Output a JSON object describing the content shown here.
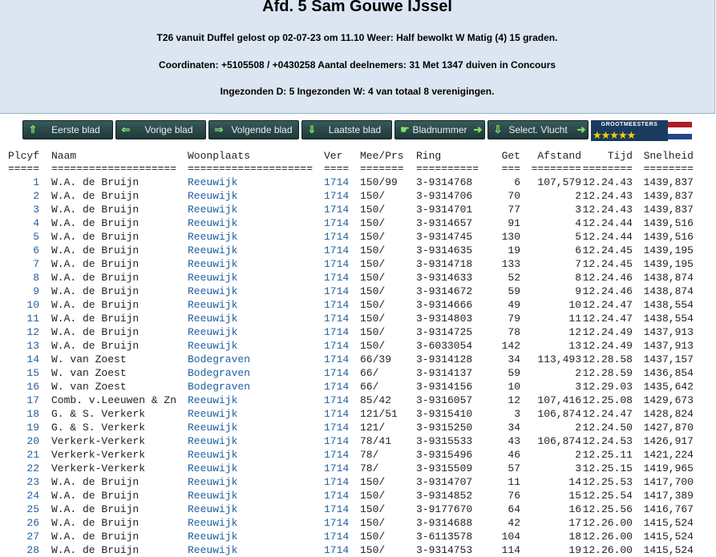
{
  "header": {
    "title": "Afd. 5 Sam Gouwe IJssel",
    "line1": "T26 vanuit Duffel gelost op 02-07-23 om 11.10 Weer: Half bewolkt W Matig (4) 15 graden.",
    "line2": "Coordinaten: +5105508 / +0430258 Aantal deelnemers: 31 Met 1347 duiven in Concours",
    "line3": "Ingezonden D: 5 Ingezonden W: 4 van totaal 8 verenigingen."
  },
  "toolbar": {
    "first": "Eerste blad",
    "prev": "Vorige blad",
    "next": "Volgende blad",
    "last": "Laatste blad",
    "page_number": "Bladnummer",
    "select_flight": "Select. Vlucht",
    "logo_text": "GROOTMEESTERS",
    "logo_stars": "★★★★★"
  },
  "colors": {
    "header_bg": "#dce6f2",
    "link": "#2160a0",
    "button_bg": "#2a4a4a",
    "arrow": "#7ee06a"
  },
  "table": {
    "headers": [
      "Plcyf",
      "Naam",
      "Woonplaats",
      "Ver",
      "Mee/Prs",
      "Ring",
      "Get",
      "Afstand",
      "Tijd",
      "Snelheid"
    ],
    "separators": [
      "=====",
      "====================",
      "====================",
      "====",
      "=======",
      "==========",
      "===",
      "========",
      "========",
      "========"
    ],
    "rows": [
      [
        "1",
        "W.A. de Bruijn",
        "Reeuwijk",
        "1714",
        "150/99",
        "3-9314768",
        "6",
        "107,579",
        "12.24.43",
        "1439,837"
      ],
      [
        "2",
        "W.A. de Bruijn",
        "Reeuwijk",
        "1714",
        "150/",
        "3-9314706",
        "70",
        "2",
        "12.24.43",
        "1439,837"
      ],
      [
        "3",
        "W.A. de Bruijn",
        "Reeuwijk",
        "1714",
        "150/",
        "3-9314701",
        "77",
        "3",
        "12.24.43",
        "1439,837"
      ],
      [
        "4",
        "W.A. de Bruijn",
        "Reeuwijk",
        "1714",
        "150/",
        "3-9314657",
        "91",
        "4",
        "12.24.44",
        "1439,516"
      ],
      [
        "5",
        "W.A. de Bruijn",
        "Reeuwijk",
        "1714",
        "150/",
        "3-9314745",
        "130",
        "5",
        "12.24.44",
        "1439,516"
      ],
      [
        "6",
        "W.A. de Bruijn",
        "Reeuwijk",
        "1714",
        "150/",
        "3-9314635",
        "19",
        "6",
        "12.24.45",
        "1439,195"
      ],
      [
        "7",
        "W.A. de Bruijn",
        "Reeuwijk",
        "1714",
        "150/",
        "3-9314718",
        "133",
        "7",
        "12.24.45",
        "1439,195"
      ],
      [
        "8",
        "W.A. de Bruijn",
        "Reeuwijk",
        "1714",
        "150/",
        "3-9314633",
        "52",
        "8",
        "12.24.46",
        "1438,874"
      ],
      [
        "9",
        "W.A. de Bruijn",
        "Reeuwijk",
        "1714",
        "150/",
        "3-9314672",
        "59",
        "9",
        "12.24.46",
        "1438,874"
      ],
      [
        "10",
        "W.A. de Bruijn",
        "Reeuwijk",
        "1714",
        "150/",
        "3-9314666",
        "49",
        "10",
        "12.24.47",
        "1438,554"
      ],
      [
        "11",
        "W.A. de Bruijn",
        "Reeuwijk",
        "1714",
        "150/",
        "3-9314803",
        "79",
        "11",
        "12.24.47",
        "1438,554"
      ],
      [
        "12",
        "W.A. de Bruijn",
        "Reeuwijk",
        "1714",
        "150/",
        "3-9314725",
        "78",
        "12",
        "12.24.49",
        "1437,913"
      ],
      [
        "13",
        "W.A. de Bruijn",
        "Reeuwijk",
        "1714",
        "150/",
        "3-6033054",
        "142",
        "13",
        "12.24.49",
        "1437,913"
      ],
      [
        "14",
        "W. van Zoest",
        "Bodegraven",
        "1714",
        "66/39",
        "3-9314128",
        "34",
        "113,493",
        "12.28.58",
        "1437,157"
      ],
      [
        "15",
        "W. van Zoest",
        "Bodegraven",
        "1714",
        "66/",
        "3-9314137",
        "59",
        "2",
        "12.28.59",
        "1436,854"
      ],
      [
        "16",
        "W. van Zoest",
        "Bodegraven",
        "1714",
        "66/",
        "3-9314156",
        "10",
        "3",
        "12.29.03",
        "1435,642"
      ],
      [
        "17",
        "Comb. v.Leeuwen & Zn",
        "Reeuwijk",
        "1714",
        "85/42",
        "3-9316057",
        "12",
        "107,416",
        "12.25.08",
        "1429,673"
      ],
      [
        "18",
        "G. & S. Verkerk",
        "Reeuwijk",
        "1714",
        "121/51",
        "3-9315410",
        "3",
        "106,874",
        "12.24.47",
        "1428,824"
      ],
      [
        "19",
        "G. & S. Verkerk",
        "Reeuwijk",
        "1714",
        "121/",
        "3-9315250",
        "34",
        "2",
        "12.24.50",
        "1427,870"
      ],
      [
        "20",
        "Verkerk-Verkerk",
        "Reeuwijk",
        "1714",
        "78/41",
        "3-9315533",
        "43",
        "106,874",
        "12.24.53",
        "1426,917"
      ],
      [
        "21",
        "Verkerk-Verkerk",
        "Reeuwijk",
        "1714",
        "78/",
        "3-9315496",
        "46",
        "2",
        "12.25.11",
        "1421,224"
      ],
      [
        "22",
        "Verkerk-Verkerk",
        "Reeuwijk",
        "1714",
        "78/",
        "3-9315509",
        "57",
        "3",
        "12.25.15",
        "1419,965"
      ],
      [
        "23",
        "W.A. de Bruijn",
        "Reeuwijk",
        "1714",
        "150/",
        "3-9314707",
        "11",
        "14",
        "12.25.53",
        "1417,700"
      ],
      [
        "24",
        "W.A. de Bruijn",
        "Reeuwijk",
        "1714",
        "150/",
        "3-9314852",
        "76",
        "15",
        "12.25.54",
        "1417,389"
      ],
      [
        "25",
        "W.A. de Bruijn",
        "Reeuwijk",
        "1714",
        "150/",
        "3-9177670",
        "64",
        "16",
        "12.25.56",
        "1416,767"
      ],
      [
        "26",
        "W.A. de Bruijn",
        "Reeuwijk",
        "1714",
        "150/",
        "3-9314688",
        "42",
        "17",
        "12.26.00",
        "1415,524"
      ],
      [
        "27",
        "W.A. de Bruijn",
        "Reeuwijk",
        "1714",
        "150/",
        "3-6113578",
        "104",
        "18",
        "12.26.00",
        "1415,524"
      ],
      [
        "28",
        "W.A. de Bruijn",
        "Reeuwijk",
        "1714",
        "150/",
        "3-9314753",
        "114",
        "19",
        "12.26.00",
        "1415,524"
      ]
    ]
  }
}
